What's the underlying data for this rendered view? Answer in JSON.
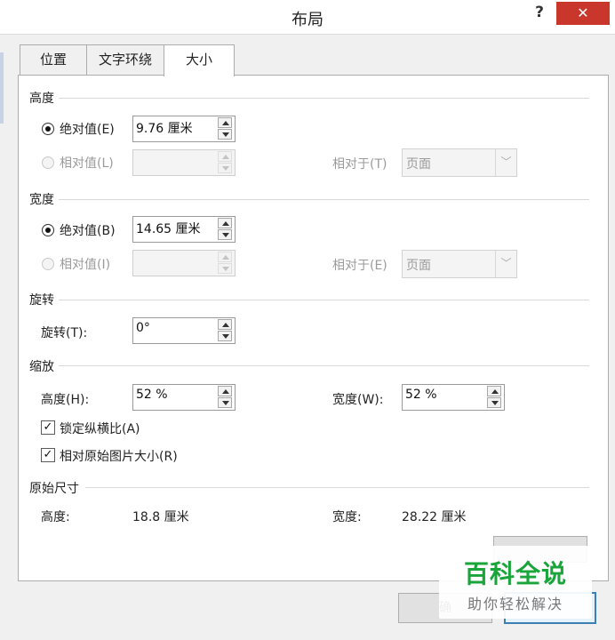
{
  "window": {
    "title": "布局",
    "help": "?",
    "close": "✕"
  },
  "tabs": [
    {
      "label": "位置"
    },
    {
      "label": "文字环绕"
    },
    {
      "label": "大小"
    }
  ],
  "height": {
    "section": "高度",
    "absolute_label": "绝对值(E)",
    "absolute_value": "9.76 厘米",
    "relative_label": "相对值(L)",
    "relative_value": "",
    "relative_to_label": "相对于(T)",
    "relative_to_value": "页面"
  },
  "width": {
    "section": "宽度",
    "absolute_label": "绝对值(B)",
    "absolute_value": "14.65 厘米",
    "relative_label": "相对值(I)",
    "relative_value": "",
    "relative_to_label": "相对于(E)",
    "relative_to_value": "页面"
  },
  "rotation": {
    "section": "旋转",
    "label": "旋转(T):",
    "value": "0°"
  },
  "scale": {
    "section": "缩放",
    "height_label": "高度(H):",
    "height_value": "52 %",
    "width_label": "宽度(W):",
    "width_value": "52 %",
    "lock_aspect_label": "锁定纵横比(A)",
    "lock_aspect_checked": true,
    "relative_original_label": "相对原始图片大小(R)",
    "relative_original_checked": true
  },
  "original": {
    "section": "原始尺寸",
    "height_label": "高度:",
    "height_value": "18.8 厘米",
    "width_label": "宽度:",
    "width_value": "28.22 厘米"
  },
  "buttons": {
    "ok_partial": "确"
  },
  "watermark": {
    "main": "百科全说",
    "sub": "助你轻松解决"
  },
  "colors": {
    "close_bg": "#c8362c",
    "watermark_green": "#1aa53b"
  }
}
